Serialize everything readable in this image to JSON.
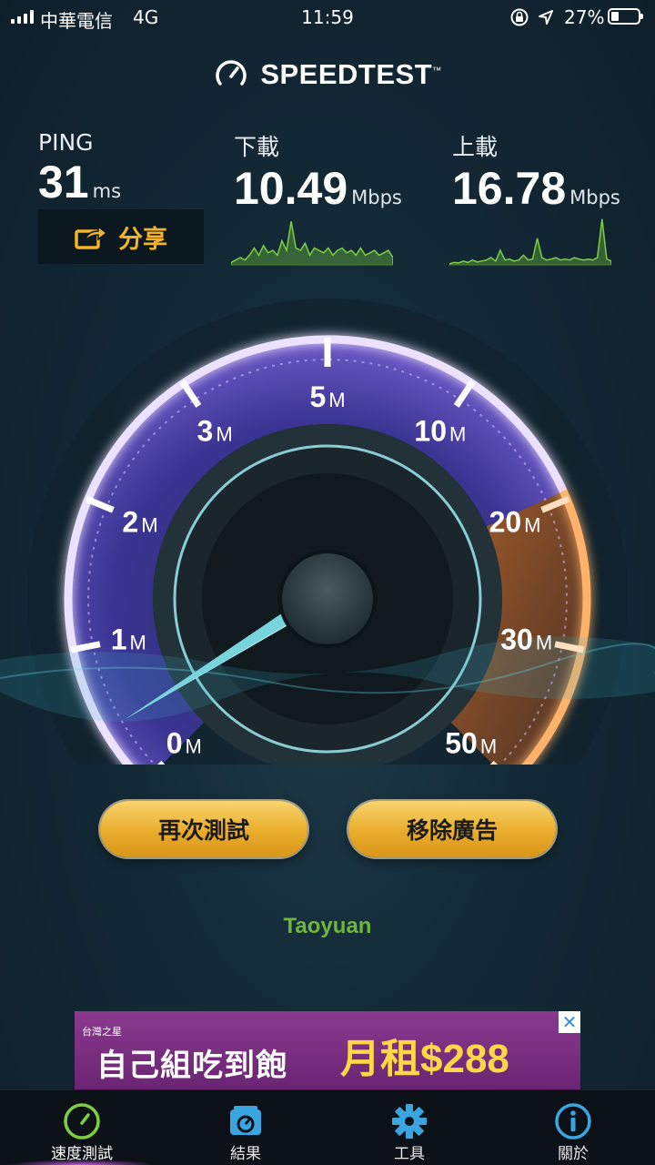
{
  "status_bar": {
    "carrier": "中華電信",
    "network": "4G",
    "time": "11:59",
    "battery_pct": "27%"
  },
  "header": {
    "title": "SPEEDTEST",
    "trademark": "™"
  },
  "stats": {
    "ping": {
      "label": "PING",
      "value": "31",
      "unit": "ms"
    },
    "download": {
      "label": "下載",
      "value": "10.49",
      "unit": "Mbps"
    },
    "upload": {
      "label": "上載",
      "value": "16.78",
      "unit": "Mbps"
    }
  },
  "share_button": {
    "label": "分享"
  },
  "gauge": {
    "ticks": [
      {
        "num": "0",
        "unit": "M"
      },
      {
        "num": "1",
        "unit": "M"
      },
      {
        "num": "2",
        "unit": "M"
      },
      {
        "num": "3",
        "unit": "M"
      },
      {
        "num": "5",
        "unit": "M"
      },
      {
        "num": "10",
        "unit": "M"
      },
      {
        "num": "20",
        "unit": "M"
      },
      {
        "num": "30",
        "unit": "M"
      },
      {
        "num": "50",
        "unit": "M"
      }
    ],
    "colors": {
      "arc": "#d9c4ff",
      "fill": "#5b4aa8",
      "upload_zone": "#f08a2a"
    }
  },
  "buttons": {
    "retest": "再次測試",
    "remove_ads": "移除廣告"
  },
  "location": "Taoyuan",
  "ad": {
    "brand": "台灣之星",
    "headline": "自己組吃到飽",
    "offer": "月租$288",
    "close": "✕"
  },
  "tabs": [
    {
      "id": "speed",
      "label": "速度測試",
      "icon": "gauge-icon"
    },
    {
      "id": "results",
      "label": "結果",
      "icon": "results-icon"
    },
    {
      "id": "tools",
      "label": "工具",
      "icon": "gear-icon"
    },
    {
      "id": "about",
      "label": "關於",
      "icon": "info-icon"
    }
  ],
  "colors": {
    "accent": "#f4b429",
    "graph": "#7ccf3e",
    "location": "#6fb63e",
    "tab_active": "#7ccf3e",
    "tab_icon": "#39a6e0"
  }
}
